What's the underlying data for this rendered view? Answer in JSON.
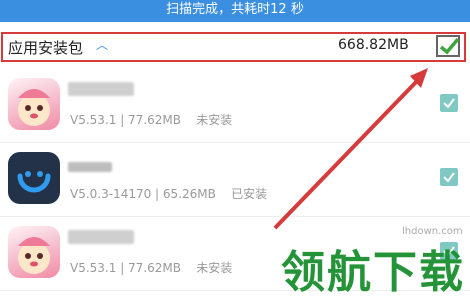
{
  "status_bar": {
    "text": "扫描完成，共耗时12 秒"
  },
  "section": {
    "title": "应用安装包",
    "size": "668.82MB",
    "checked": true
  },
  "apps": [
    {
      "icon": "pink-cartoon-icon",
      "version_info": "V5.53.1 | 77.62MB",
      "install_status": "未安装",
      "checked": true
    },
    {
      "icon": "blue-smile-icon",
      "version_info": "V5.0.3-14170 | 65.26MB",
      "install_status": "已安装",
      "checked": true
    },
    {
      "icon": "pink-cartoon-icon",
      "version_info": "V5.53.1 | 77.62MB",
      "install_status": "未安装",
      "checked": true
    }
  ],
  "watermark": {
    "text": "领航下载",
    "url": "lhdown.com"
  },
  "colors": {
    "accent": "#3a8fe0",
    "check": "#7fc9c2",
    "highlight": "#d73a3a",
    "watermark": "#1a8f2e"
  }
}
